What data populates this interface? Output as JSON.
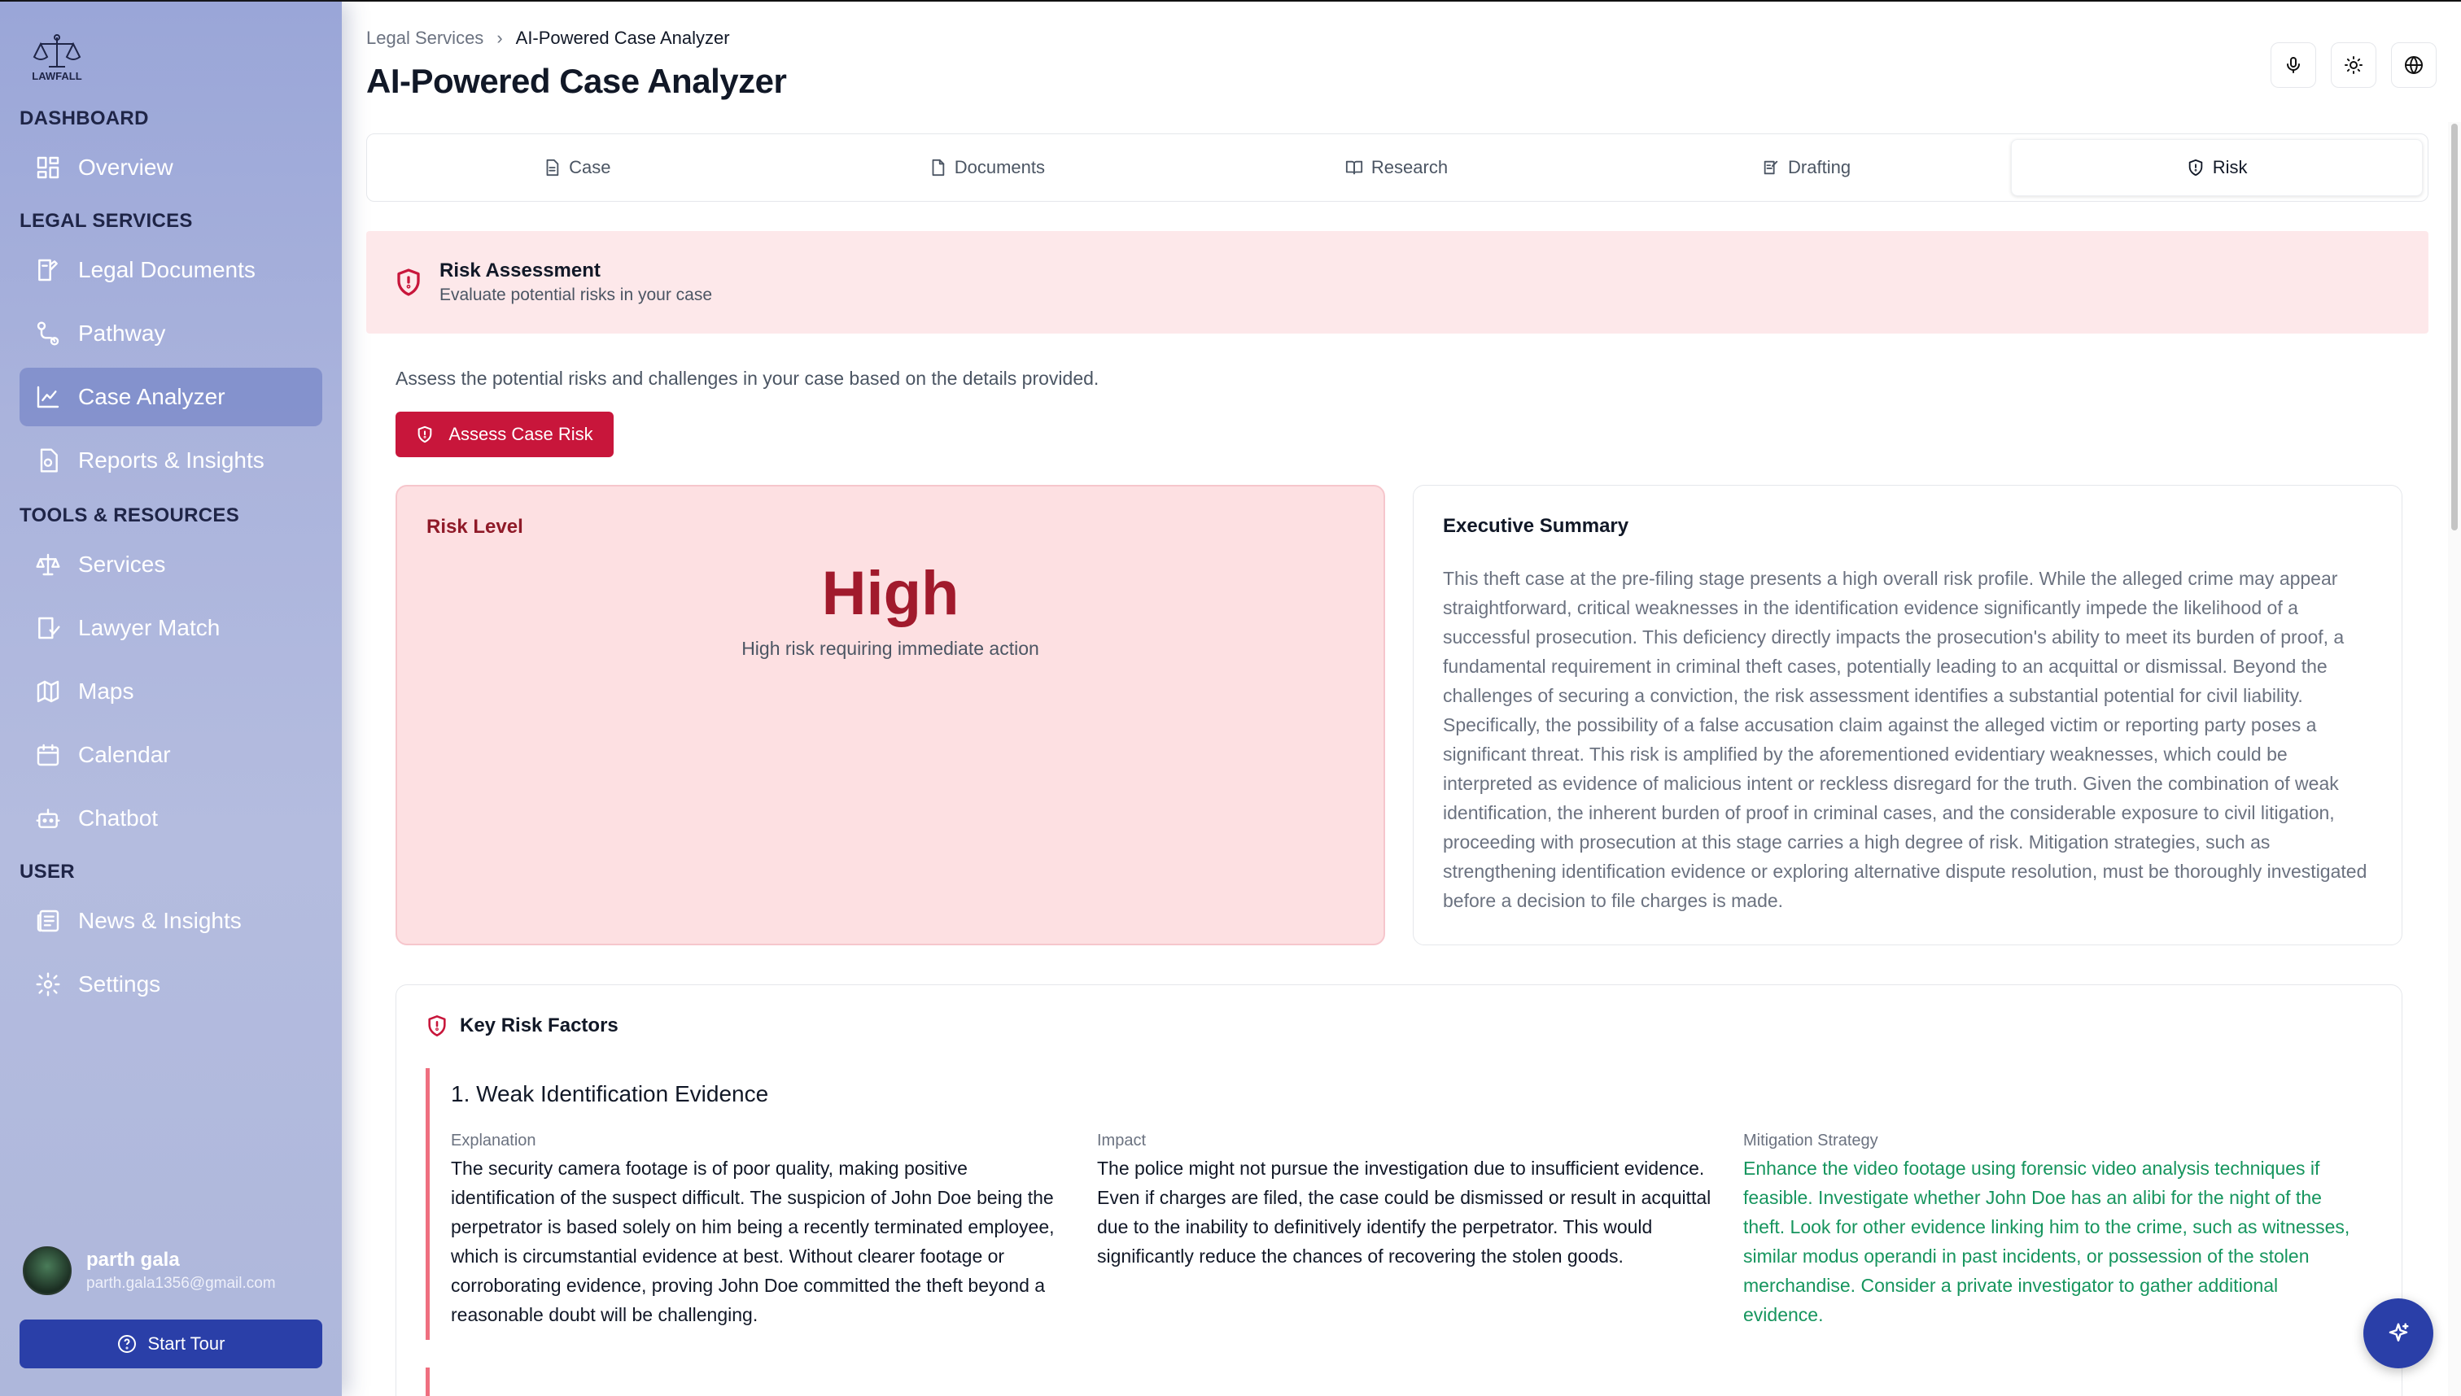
{
  "app": {
    "logo_text": "LAWFALL"
  },
  "sidebar": {
    "sections": {
      "dashboard": "DASHBOARD",
      "legal_services": "LEGAL SERVICES",
      "tools": "TOOLS & RESOURCES",
      "user": "USER"
    },
    "items": [
      {
        "label": "Overview",
        "icon": "grid-icon"
      },
      {
        "label": "Legal Documents",
        "icon": "document-edit-icon"
      },
      {
        "label": "Pathway",
        "icon": "route-icon"
      },
      {
        "label": "Case Analyzer",
        "icon": "chart-line-icon",
        "active": true
      },
      {
        "label": "Reports & Insights",
        "icon": "file-report-icon"
      },
      {
        "label": "Services",
        "icon": "scale-icon"
      },
      {
        "label": "Lawyer Match",
        "icon": "user-check-icon"
      },
      {
        "label": "Maps",
        "icon": "map-icon"
      },
      {
        "label": "Calendar",
        "icon": "calendar-icon"
      },
      {
        "label": "Chatbot",
        "icon": "bot-icon"
      },
      {
        "label": "News & Insights",
        "icon": "newspaper-icon"
      },
      {
        "label": "Settings",
        "icon": "gear-icon"
      }
    ],
    "user": {
      "name": "parth gala",
      "email": "parth.gala1356@gmail.com"
    },
    "tour_button": "Start Tour"
  },
  "header": {
    "breadcrumb": [
      "Legal Services",
      "AI-Powered Case Analyzer"
    ],
    "title": "AI-Powered Case Analyzer"
  },
  "tabs": [
    {
      "label": "Case",
      "icon": "file-text-icon"
    },
    {
      "label": "Documents",
      "icon": "file-icon"
    },
    {
      "label": "Research",
      "icon": "book-open-icon"
    },
    {
      "label": "Drafting",
      "icon": "draft-icon"
    },
    {
      "label": "Risk",
      "icon": "shield-icon",
      "active": true
    }
  ],
  "risk": {
    "banner_title": "Risk Assessment",
    "banner_subtitle": "Evaluate potential risks in your case",
    "description": "Assess the potential risks and challenges in your case based on the details provided.",
    "assess_button": "Assess Case Risk",
    "level_label": "Risk Level",
    "level_value": "High",
    "level_desc": "High risk requiring immediate action",
    "summary_label": "Executive Summary",
    "summary_text": "This theft case at the pre-filing stage presents a high overall risk profile. While the alleged crime may appear straightforward, critical weaknesses in the identification evidence significantly impede the likelihood of a successful prosecution. This deficiency directly impacts the prosecution's ability to meet its burden of proof, a fundamental requirement in criminal theft cases, potentially leading to an acquittal or dismissal. Beyond the challenges of securing a conviction, the risk assessment identifies a substantial potential for civil liability. Specifically, the possibility of a false accusation claim against the alleged victim or reporting party poses a significant threat. This risk is amplified by the aforementioned evidentiary weaknesses, which could be interpreted as evidence of malicious intent or reckless disregard for the truth. Given the combination of weak identification, the inherent burden of proof in criminal cases, and the considerable exposure to civil litigation, proceeding with prosecution at this stage carries a high degree of risk. Mitigation strategies, such as strengthening identification evidence or exploring alternative dispute resolution, must be thoroughly investigated before a decision to file charges is made.",
    "factors_label": "Key Risk Factors",
    "factors": [
      {
        "title": "1. Weak Identification Evidence",
        "explanation_label": "Explanation",
        "explanation": "The security camera footage is of poor quality, making positive identification of the suspect difficult. The suspicion of John Doe being the perpetrator is based solely on him being a recently terminated employee, which is circumstantial evidence at best. Without clearer footage or corroborating evidence, proving John Doe committed the theft beyond a reasonable doubt will be challenging.",
        "impact_label": "Impact",
        "impact": "The police might not pursue the investigation due to insufficient evidence. Even if charges are filed, the case could be dismissed or result in acquittal due to the inability to definitively identify the perpetrator. This would significantly reduce the chances of recovering the stolen goods.",
        "mitigation_label": "Mitigation Strategy",
        "mitigation": "Enhance the video footage using forensic video analysis techniques if feasible. Investigate whether John Doe has an alibi for the night of the theft. Look for other evidence linking him to the crime, such as witnesses, similar modus operandi in past incidents, or possession of the stolen merchandise. Consider a private investigator to gather additional evidence."
      }
    ]
  },
  "colors": {
    "accent": "#c8163b",
    "brand": "#2a3fa8",
    "risk_high": "#a11a2c",
    "mitigation_green": "#16955e"
  }
}
